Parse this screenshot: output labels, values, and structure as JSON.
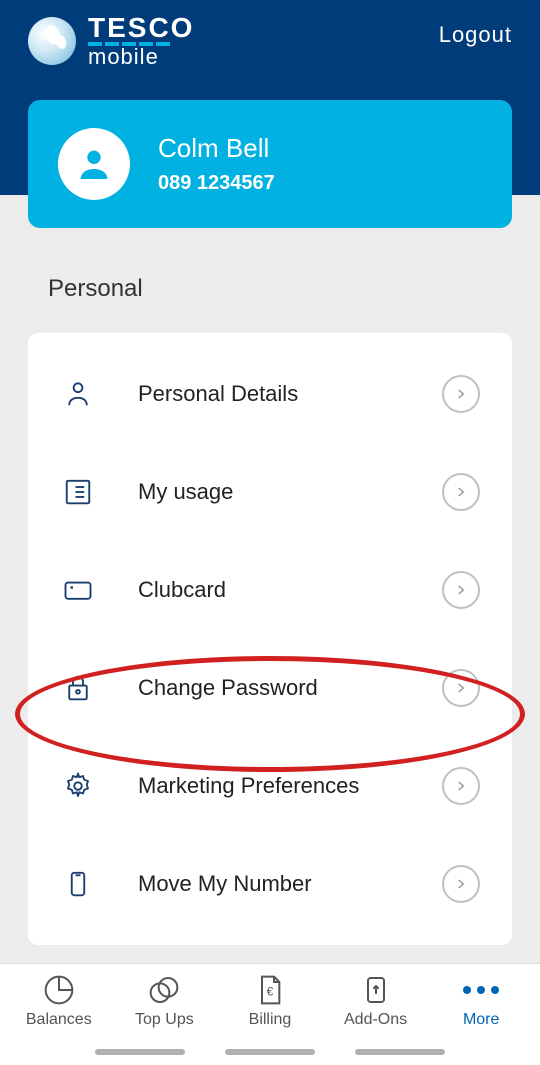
{
  "brand": {
    "main": "TESCO",
    "sub": "mobile"
  },
  "header": {
    "logout": "Logout"
  },
  "profile": {
    "name": "Colm Bell",
    "phone": "089 1234567"
  },
  "section": {
    "title": "Personal"
  },
  "menu": {
    "items": [
      {
        "label": "Personal Details"
      },
      {
        "label": "My usage"
      },
      {
        "label": "Clubcard"
      },
      {
        "label": "Change Password"
      },
      {
        "label": "Marketing Preferences"
      },
      {
        "label": "Move My Number"
      }
    ]
  },
  "nav": {
    "items": [
      {
        "label": "Balances"
      },
      {
        "label": "Top Ups"
      },
      {
        "label": "Billing"
      },
      {
        "label": "Add-Ons"
      },
      {
        "label": "More"
      }
    ]
  }
}
